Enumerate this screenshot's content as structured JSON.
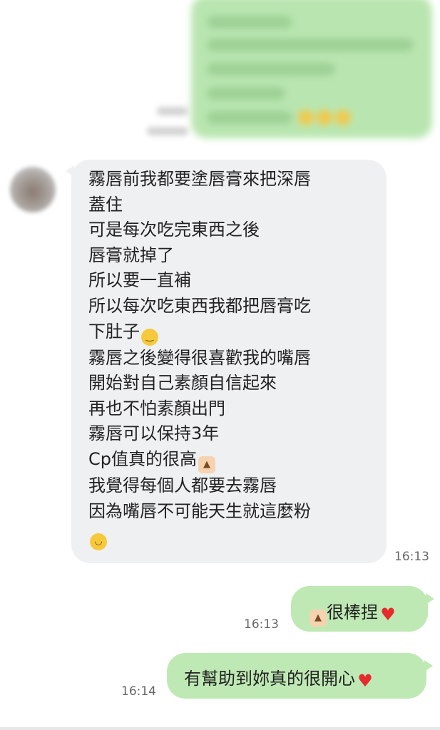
{
  "incoming_message": {
    "lines": [
      "霧唇前我都要塗唇膏來把深唇",
      "蓋住",
      "可是每次吃完東西之後",
      "唇膏就掉了",
      "所以要一直補",
      "所以每次吃東西我都把唇膏吃",
      "下肚子",
      "霧唇之後變得很喜歡我的嘴唇",
      "開始對自己素顏自信起來",
      "再也不怕素顏出門",
      "霧唇可以保持3年",
      "Cp值真的很高",
      "我覺得每個人都要去霧唇",
      "因為嘴唇不可能天生就這麼粉",
      ""
    ],
    "time": "16:13",
    "line_emojis": {
      "6": "pensive-face-emoji",
      "11": "thumbs-up-emoji",
      "14": "laughing-tears-emoji"
    }
  },
  "outgoing_messages": [
    {
      "text": "很棒捏",
      "leading_emoji": "thumbs-up-emoji",
      "trailing_emoji": "red-heart-emoji",
      "time": "16:13"
    },
    {
      "text": "有幫助到妳真的很開心",
      "trailing_emoji": "red-heart-emoji",
      "time": "16:14"
    }
  ],
  "colors": {
    "incoming_bubble": "#eff0f2",
    "outgoing_bubble": "#bfe9b4",
    "text": "#222222",
    "time_text": "#666666"
  }
}
